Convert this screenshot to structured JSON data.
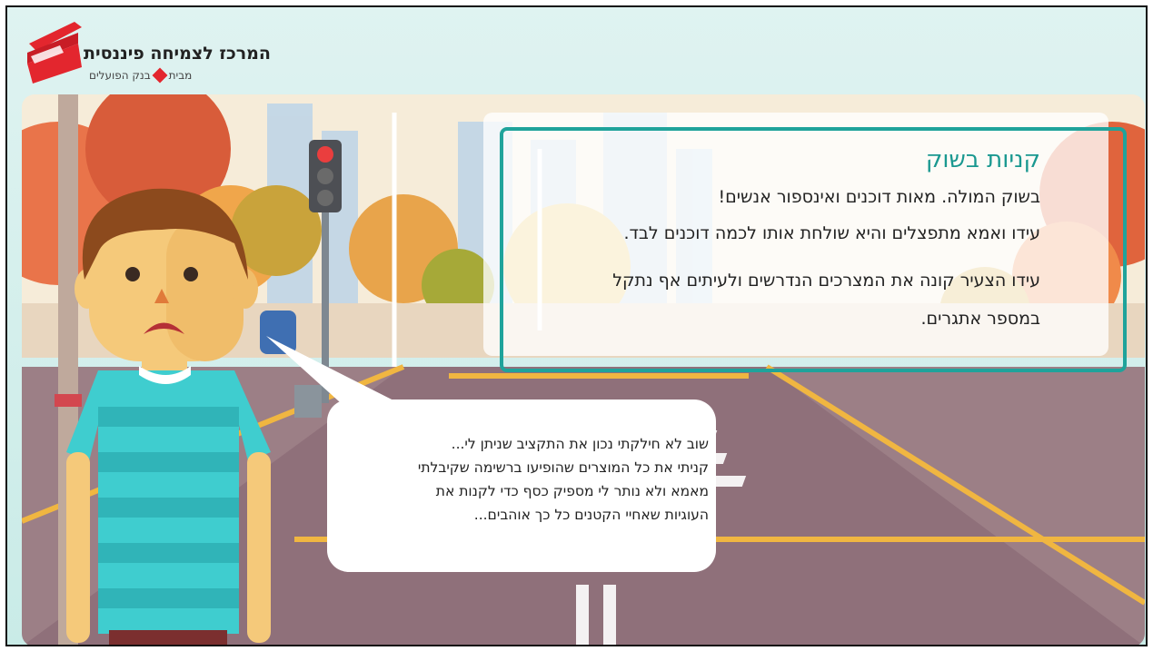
{
  "brand": {
    "title": "המרכז לצמיחה פיננסית",
    "subtitle_prefix": "מבית",
    "subtitle_bank": "בנק הפועלים",
    "logo_color": "#e3262e"
  },
  "info_card": {
    "title": "קניות בשוק",
    "lines": [
      "בשוק המולה. מאות דוכנים ואינספור אנשים!",
      "עידו ואמא מתפצלים והיא שולחת אותו לכמה דוכנים לבד.",
      "עידו הצעיר קונה את המצרכים הנדרשים ולעיתים אף נתקל",
      "במספר אתגרים."
    ],
    "accent_color": "#1fa39b"
  },
  "speech_bubble": {
    "lines": [
      "שוב לא חילקתי נכון את התקציב שניתן לי...",
      "קניתי את כל המוצרים שהופיעו ברשימה שקיבלתי",
      "מאמא ולא נותר לי מספיק כסף כדי לקנות את",
      "העוגיות שאחיי הקטנים כל כך אוהבים..."
    ]
  },
  "character": {
    "name": "עידו",
    "mood": "sad"
  }
}
